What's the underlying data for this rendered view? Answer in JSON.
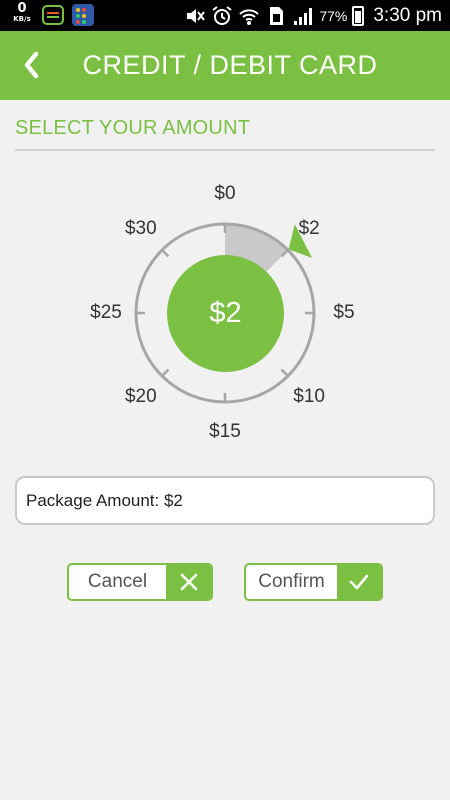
{
  "status_bar": {
    "data_rate_value": "0",
    "data_rate_unit": "KB/s",
    "battery_percent": "77%",
    "time": "3:30 pm"
  },
  "header": {
    "back_icon": "chevron-left-icon",
    "title": "CREDIT / DEBIT CARD"
  },
  "section": {
    "title": "SELECT YOUR AMOUNT"
  },
  "dial": {
    "options": [
      "$0",
      "$2",
      "$5",
      "$10",
      "$15",
      "$20",
      "$25",
      "$30"
    ],
    "selected_value": "$2",
    "selected_fraction": 0.125,
    "colors": {
      "accent": "#7cc043",
      "ring": "#a6a6a6",
      "selection_fill": "#c9c9c9"
    }
  },
  "amount_field": {
    "value": "Package Amount: $2"
  },
  "buttons": {
    "cancel_label": "Cancel",
    "cancel_icon": "close-icon",
    "confirm_label": "Confirm",
    "confirm_icon": "check-icon"
  },
  "colors": {
    "brand": "#7cc043",
    "background": "#f1f1f1"
  }
}
